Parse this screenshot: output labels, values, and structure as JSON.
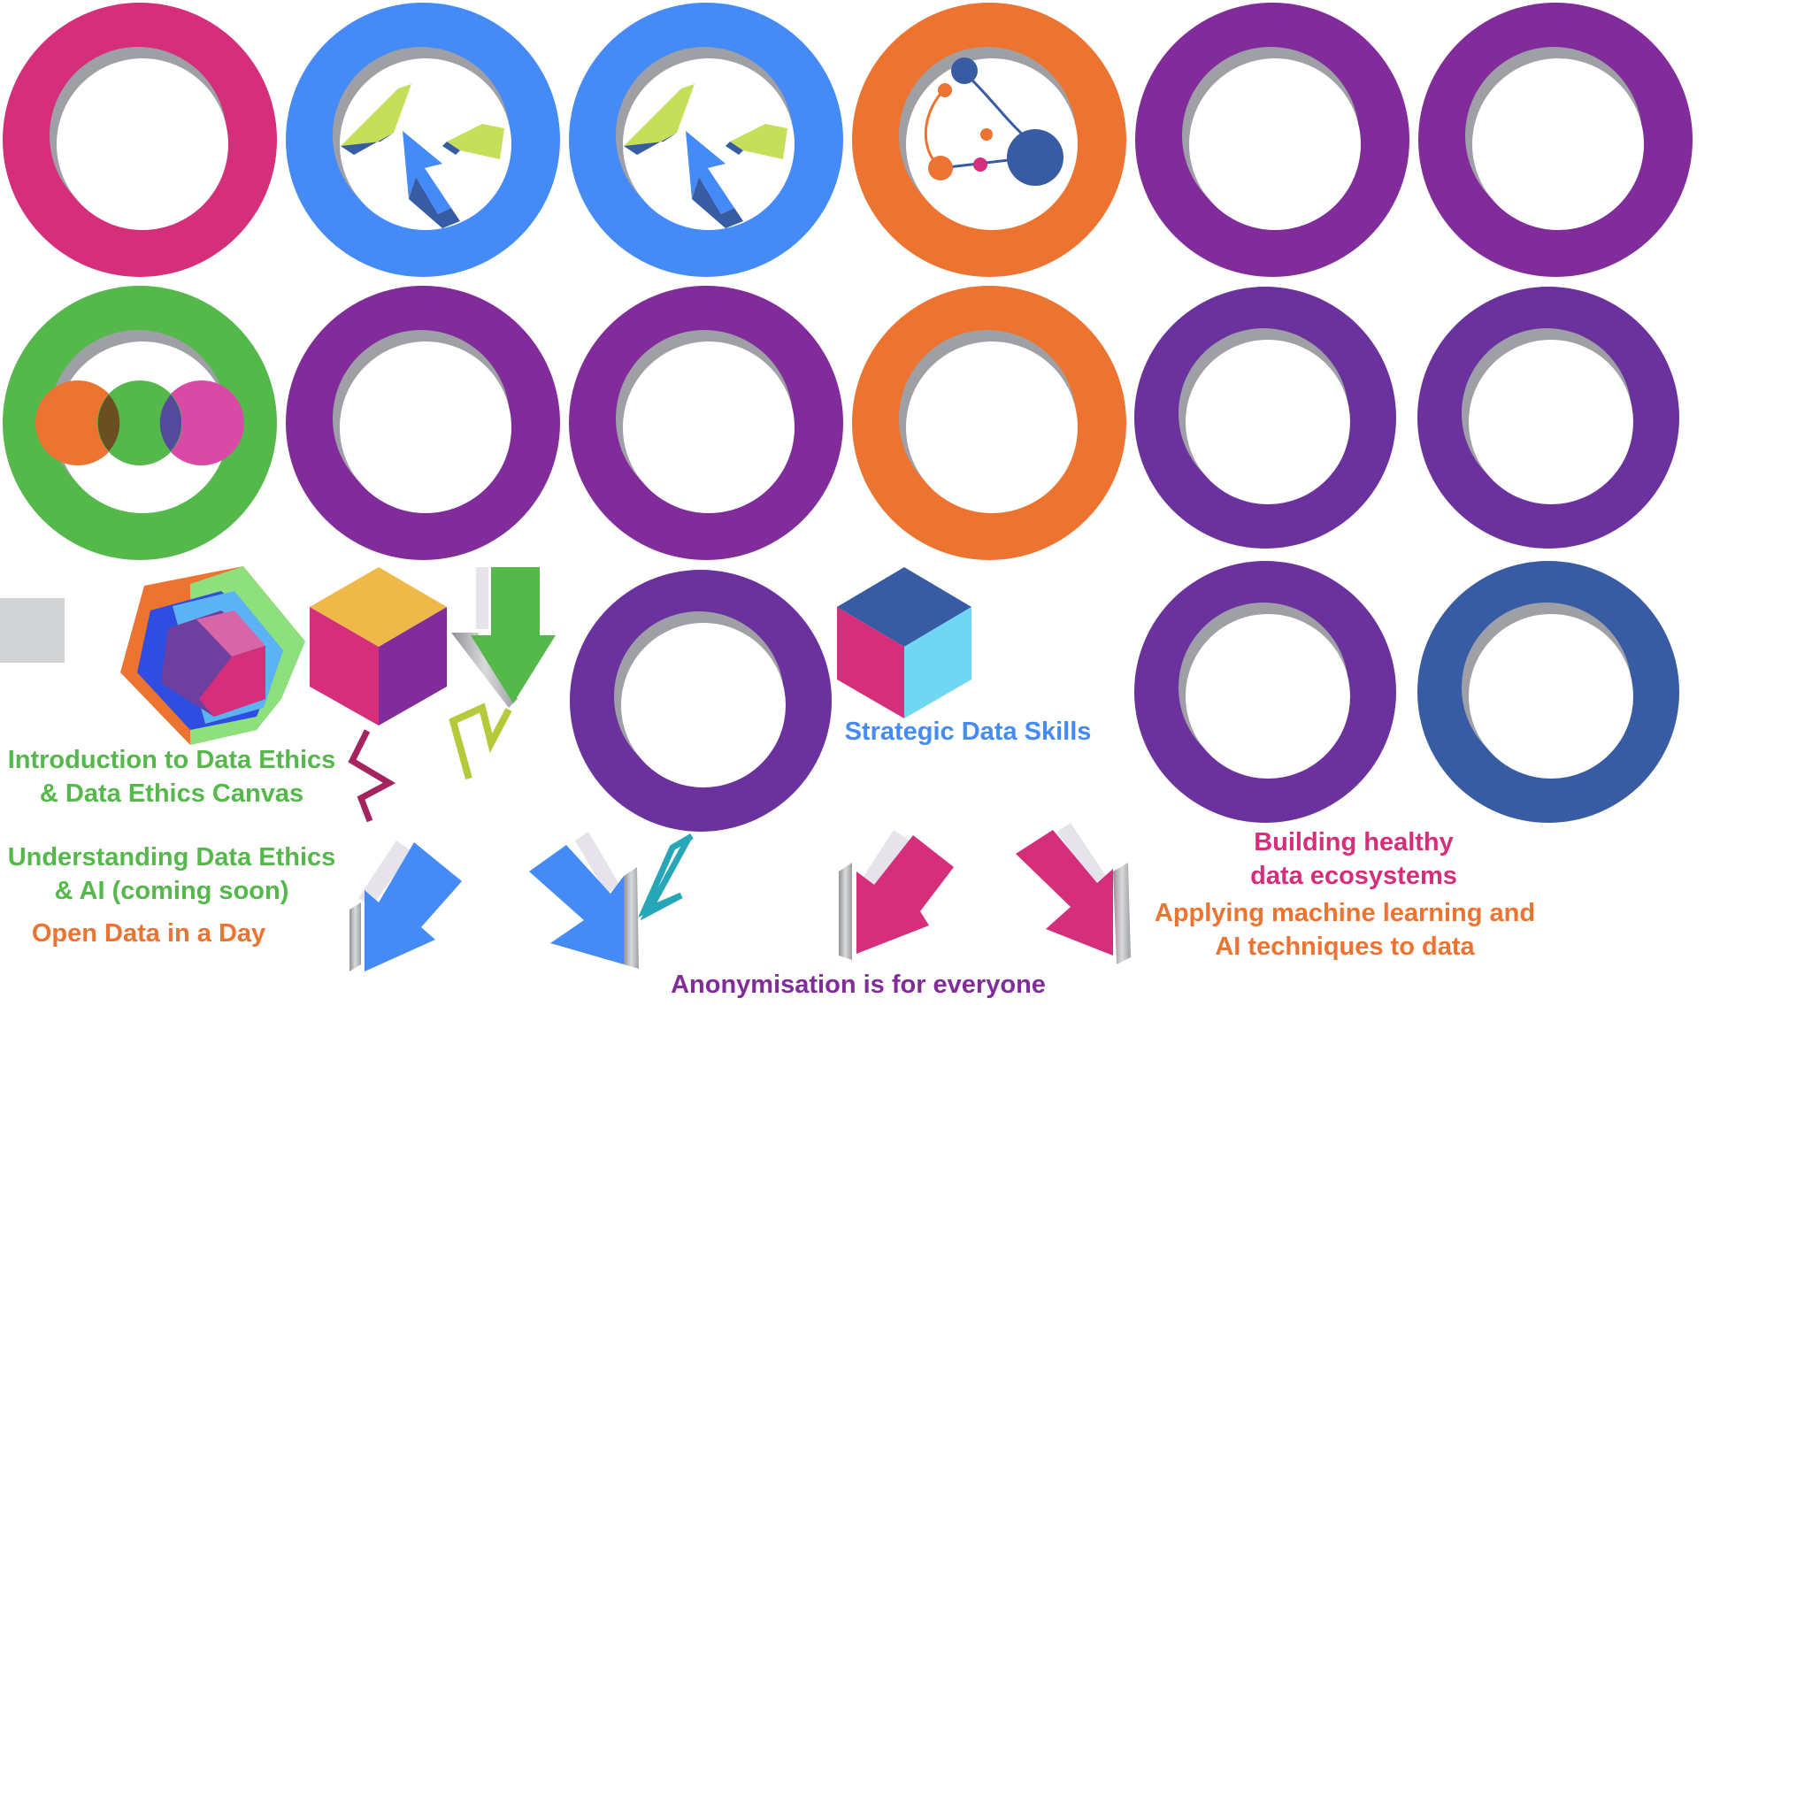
{
  "palette": {
    "magenta": "#d52e7a",
    "blue": "#458bf7",
    "orange": "#ec7330",
    "purple": "#822b9b",
    "violet": "#6b329e",
    "navy": "#385ca4",
    "green": "#55b84b",
    "lime": "#c6df5a",
    "sky": "#6fd6f3",
    "gold": "#efb94a",
    "grey": "#d2d3d4"
  },
  "rings": [
    {
      "name": "ring-magenta",
      "color": "magenta",
      "icon": "empty"
    },
    {
      "name": "ring-blue-cursor-a",
      "color": "blue",
      "icon": "cursor-arrows-icon"
    },
    {
      "name": "ring-blue-cursor-b",
      "color": "blue",
      "icon": "cursor-arrows-icon"
    },
    {
      "name": "ring-orange-network",
      "color": "orange",
      "icon": "network-nodes-icon"
    },
    {
      "name": "ring-purple-a",
      "color": "purple",
      "icon": "empty"
    },
    {
      "name": "ring-purple-b",
      "color": "purple",
      "icon": "empty"
    },
    {
      "name": "ring-green-venn",
      "color": "green",
      "icon": "venn-circles-icon"
    },
    {
      "name": "ring-purple-c",
      "color": "purple",
      "icon": "empty"
    },
    {
      "name": "ring-purple-d",
      "color": "purple",
      "icon": "empty"
    },
    {
      "name": "ring-orange-empty",
      "color": "orange",
      "icon": "empty"
    },
    {
      "name": "ring-violet-a",
      "color": "violet",
      "icon": "empty"
    },
    {
      "name": "ring-violet-b",
      "color": "violet",
      "icon": "empty"
    },
    {
      "name": "ring-violet-c",
      "color": "violet",
      "icon": "empty"
    },
    {
      "name": "ring-violet-d",
      "color": "violet",
      "icon": "empty"
    },
    {
      "name": "ring-navy",
      "color": "navy",
      "icon": "empty"
    }
  ],
  "labels": {
    "intro_ethics": {
      "line1": "Introduction to Data Ethics",
      "line2": "& Data Ethics Canvas",
      "color": "green"
    },
    "understanding_ethics": {
      "line1": "Understanding Data Ethics",
      "line2": "& AI (coming soon)",
      "color": "green"
    },
    "open_data": {
      "text": "Open Data in a Day",
      "color": "orange"
    },
    "strategic_skills": {
      "text": "Strategic Data Skills",
      "color": "blue"
    },
    "anonymisation": {
      "text": "Anonymisation is for everyone",
      "color": "purple"
    },
    "ecosystems": {
      "line1": "Building healthy",
      "line2": "data ecosystems",
      "color": "magenta"
    },
    "ml_ai": {
      "line1": "Applying machine learning and",
      "line2": "AI techniques to data",
      "color": "orange"
    }
  }
}
